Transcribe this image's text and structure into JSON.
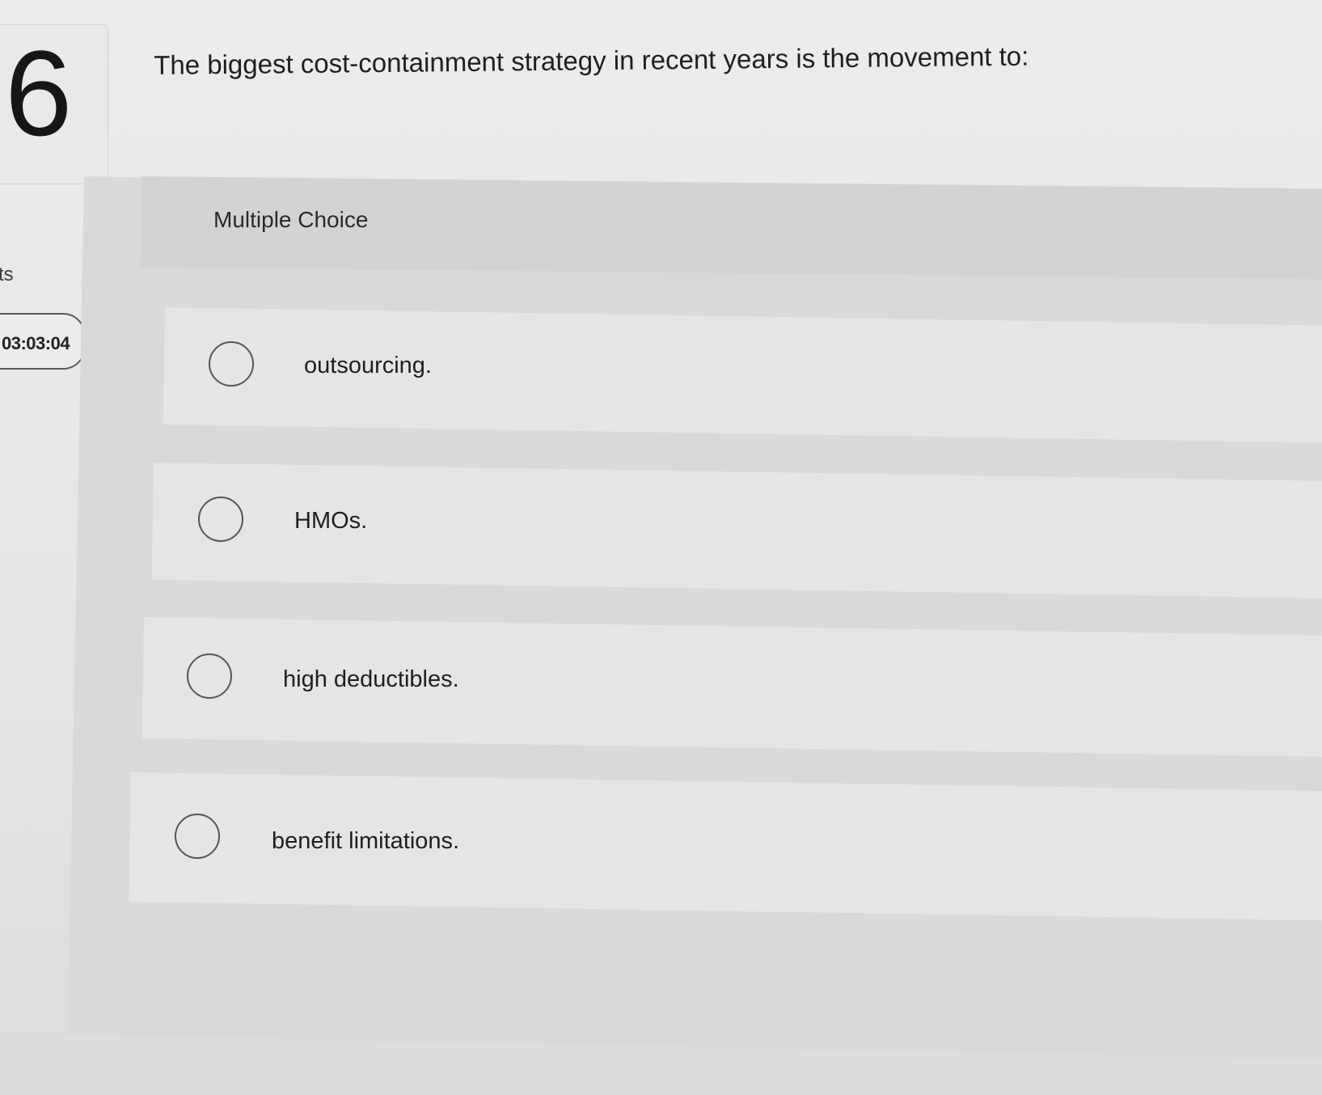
{
  "question": {
    "number": "6",
    "text": "The biggest cost-containment strategy in recent years is the movement to:"
  },
  "sidebar": {
    "points_partial": "ts",
    "timer": "03:03:04"
  },
  "answer_area": {
    "type_label": "Multiple Choice",
    "options": [
      {
        "label": "outsourcing."
      },
      {
        "label": "HMOs."
      },
      {
        "label": "high deductibles."
      },
      {
        "label": "benefit limitations."
      }
    ]
  }
}
